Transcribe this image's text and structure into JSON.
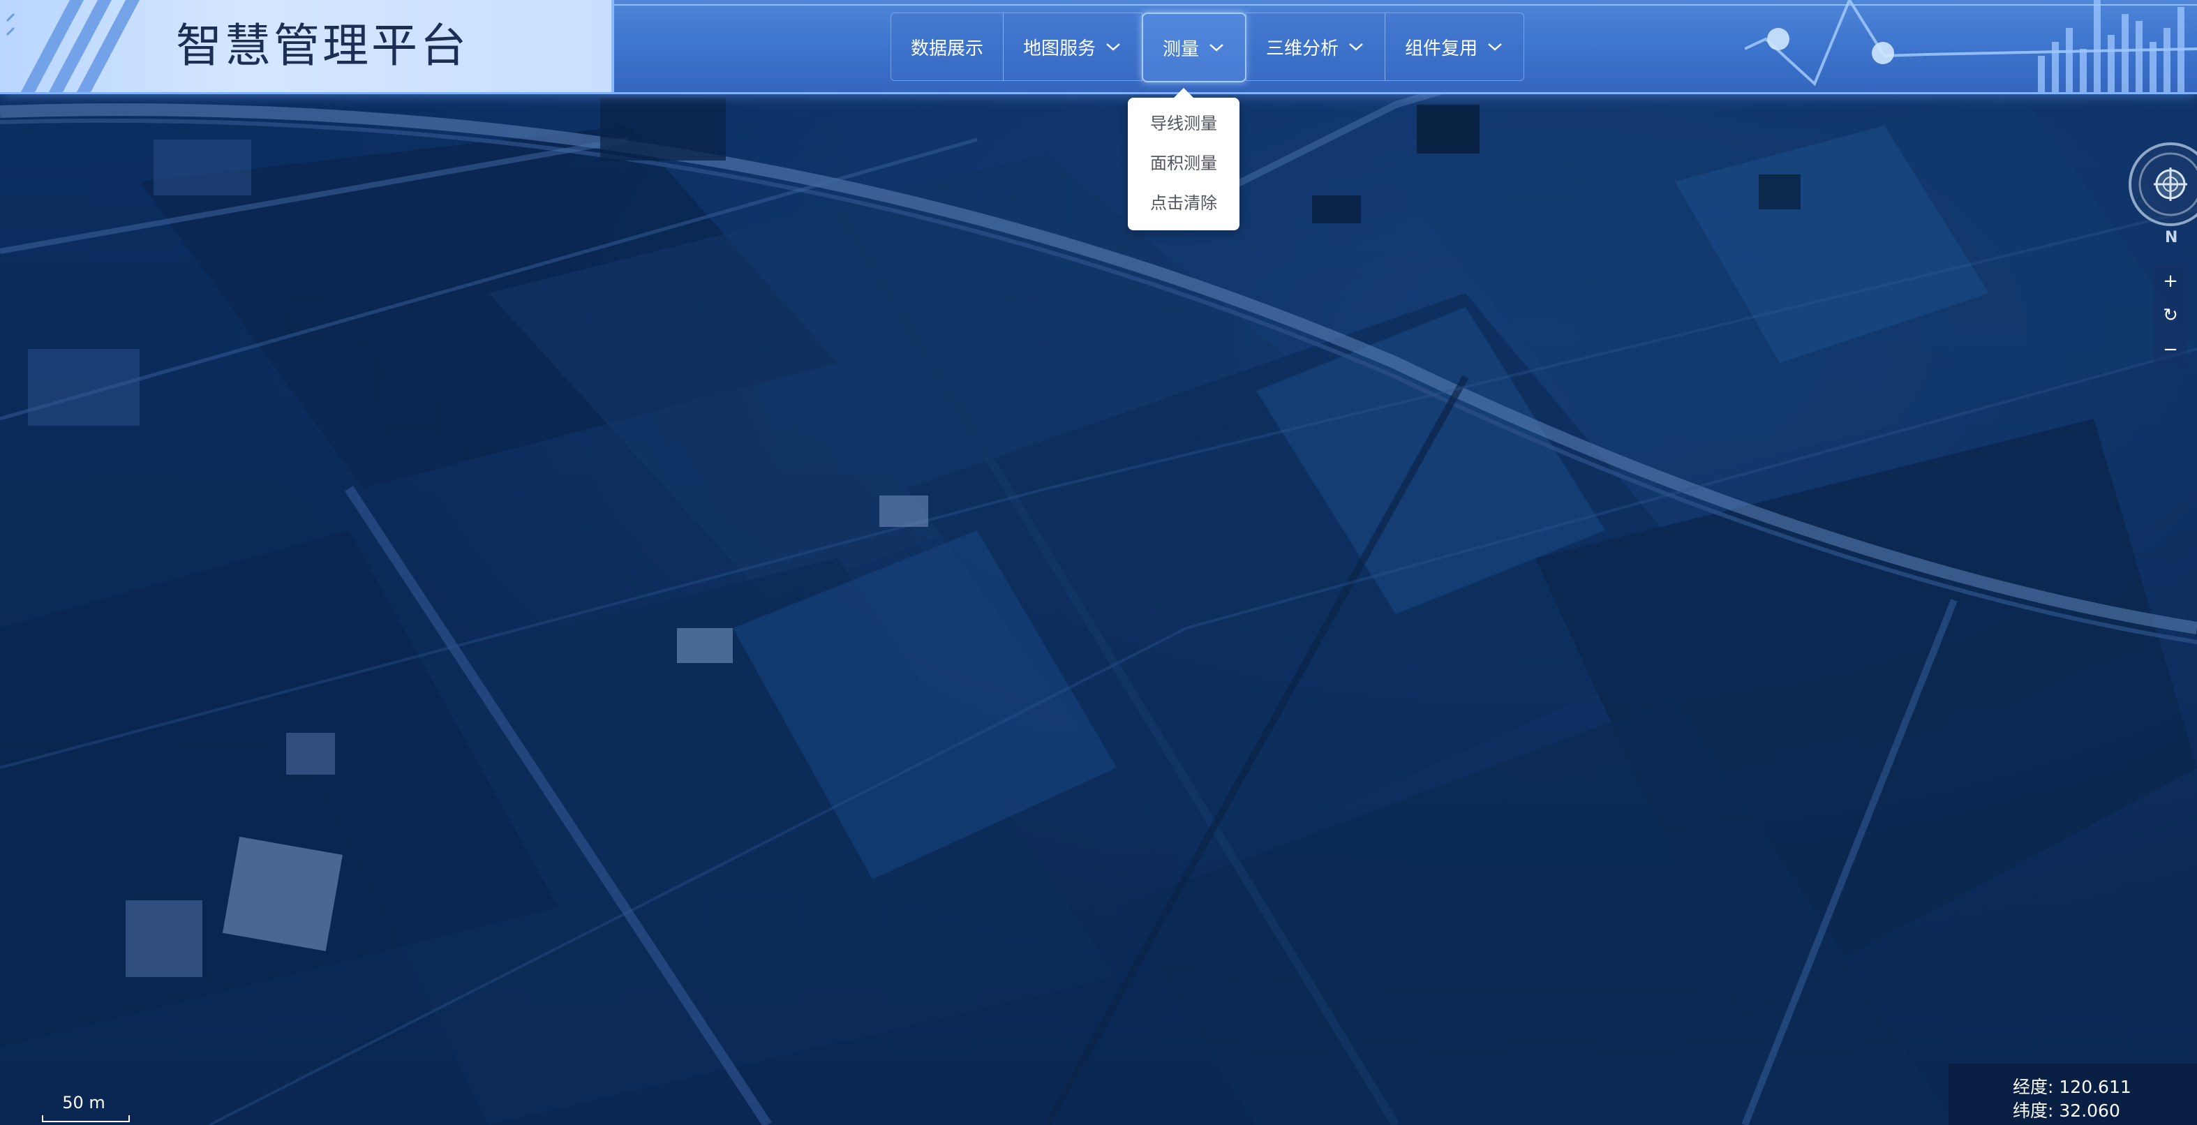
{
  "header": {
    "title": "智慧管理平台",
    "nav": [
      {
        "label": "数据展示",
        "has_dropdown": false,
        "active": false
      },
      {
        "label": "地图服务",
        "has_dropdown": true,
        "active": false
      },
      {
        "label": "测量",
        "has_dropdown": true,
        "active": true
      },
      {
        "label": "三维分析",
        "has_dropdown": true,
        "active": false
      },
      {
        "label": "组件复用",
        "has_dropdown": true,
        "active": false
      }
    ]
  },
  "measure_menu": {
    "items": [
      "导线测量",
      "面积测量",
      "点击清除"
    ]
  },
  "map_controls": {
    "compass_north": "N",
    "zoom_in": "+",
    "reset": "↻",
    "zoom_out": "−"
  },
  "status": {
    "longitude_label": "经度:",
    "longitude": "120.611",
    "latitude_label": "纬度:",
    "latitude": "32.060",
    "scale_label": "50 m"
  },
  "colors": {
    "header_bg": "#3c73cc",
    "logo_panel": "#c8dfff",
    "map_tint": "#0b2f63",
    "dropdown_bg": "#ffffff"
  }
}
